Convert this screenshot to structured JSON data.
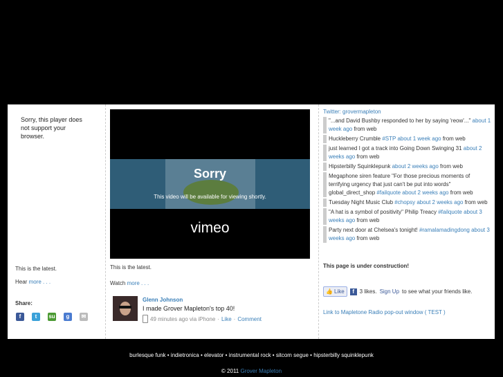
{
  "col1": {
    "sorry": "Sorry, this player does not support your browser.",
    "latest": "This is the latest.",
    "hear_prefix": "Hear ",
    "hear_link": "more . . .",
    "share_label": "Share:",
    "share_icons": [
      {
        "name": "facebook-icon",
        "glyph": "f",
        "color": "#3b5998"
      },
      {
        "name": "twitter-icon",
        "glyph": "t",
        "color": "#3aa1d9"
      },
      {
        "name": "stumbleupon-icon",
        "glyph": "su",
        "color": "#4b9a33"
      },
      {
        "name": "google-icon",
        "glyph": "g",
        "color": "#4a7bd0"
      },
      {
        "name": "email-icon",
        "glyph": "✉",
        "color": "#bbbbbb"
      }
    ]
  },
  "col2": {
    "video": {
      "title": "Sorry",
      "subtitle": "This video will be available for viewing shortly.",
      "logo": "vimeo"
    },
    "latest": "This is the latest.",
    "watch_prefix": "Watch ",
    "watch_link": "more . . .",
    "post": {
      "name": "Glenn Johnson",
      "text": "I made Grover Mapleton's top 40!",
      "time": "49 minutes ago via iPhone",
      "sep": "·",
      "like": "Like",
      "comment": "Comment"
    }
  },
  "col3": {
    "twitter_header": "Twitter: grovermapleton",
    "tweets": [
      {
        "text": "\"...and David Bushby responded to her by saying 'reow'...\" ",
        "link": "about 1 week ago",
        "suffix": " from web"
      },
      {
        "text": "Huckleberry Crumble ",
        "link": "#STP about 1 week ago",
        "suffix": " from web"
      },
      {
        "text": "just learned I got a track into Going Down Swinging 31 ",
        "link": "about 2 weeks ago",
        "suffix": " from web"
      },
      {
        "text": "Hipsterbilly Squinklepunk ",
        "link": "about 2 weeks ago",
        "suffix": " from web"
      },
      {
        "text": "Megaphone siren feature \"For those precious moments of terrifying urgency that just can't be put into words\" global_direct_shop ",
        "link": "#failquote about 2 weeks ago",
        "suffix": " from web"
      },
      {
        "text": "Tuesday Night Music Club ",
        "link": "#chopsy about 2 weeks ago",
        "suffix": " from web"
      },
      {
        "text": "\"A hat is a symbol of positivity\" Philip Treacy ",
        "link": "#failquote about 3 weeks ago",
        "suffix": " from web"
      },
      {
        "text": "Party next door at Chelsea's tonight! ",
        "link": "#ramalamadingdong about 3 weeks ago",
        "suffix": " from web"
      }
    ],
    "construction": "This page is under construction!",
    "fb": {
      "like_button": "Like",
      "likes": "3 likes.",
      "signup": "Sign Up",
      "suffix": " to see what your friends like."
    },
    "popout": "Link to Mapletone Radio pop-out window ( TEST )"
  },
  "footer": {
    "tags": "burlesque funk • indietronica • elevator • instrumental rock • sitcom segue • hipsterbilly squinklepunk",
    "copyright_prefix": "© 2011 ",
    "copyright_link": "Grover Mapleton"
  }
}
